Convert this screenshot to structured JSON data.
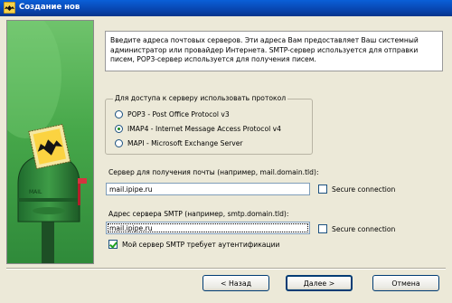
{
  "window": {
    "title": "Создание нов",
    "app_icon": "bat-icon"
  },
  "info_text": "Введите адреса почтовых серверов. Эти адреса Вам предоставляет Ваш системный администратор или провайдер Интернета. SMTP-сервер используется для отправки писем, POP3-сервер используется для получения писем.",
  "protocol_group": {
    "legend": "Для доступа к серверу использовать протокол",
    "options": [
      {
        "label": "POP3 - Post Office Protocol v3",
        "checked": false
      },
      {
        "label": "IMAP4 - Internet Message Access Protocol v4",
        "checked": true
      },
      {
        "label": "MAPI - Microsoft Exchange Server",
        "checked": false
      }
    ]
  },
  "incoming": {
    "label": "Сервер для получения почты  (например, mail.domain.tld):",
    "value": "mail.ipipe.ru",
    "secure_label": "Secure connection",
    "secure_checked": false
  },
  "smtp": {
    "label": "Адрес сервера SMTP (например, smtp.domain.tld):",
    "value": "mail.ipipe.ru",
    "secure_label": "Secure connection",
    "secure_checked": false,
    "auth_label": "Мой сервер SMTP требует аутентификации",
    "auth_checked": true
  },
  "buttons": {
    "back": "< Назад",
    "next": "Далее >",
    "cancel": "Отмена"
  },
  "colors": {
    "titlebar": "#0a5fd8",
    "panel": "#47a84a",
    "window_bg": "#ece9d8"
  }
}
